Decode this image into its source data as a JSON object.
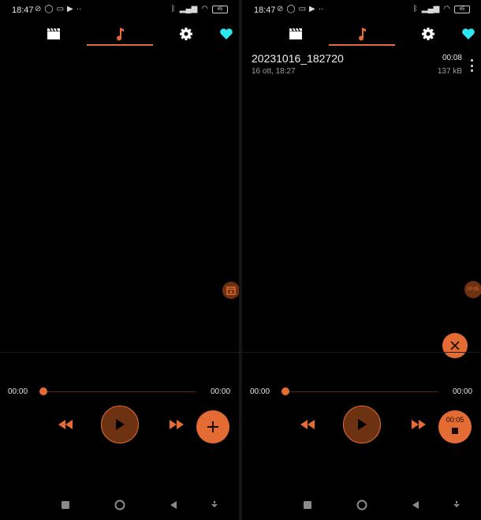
{
  "theme": {
    "accent": "#e56b34",
    "accent_dark": "#6d3212",
    "background": "#000000",
    "favorite_color": "#2ee6f0"
  },
  "status_bar": {
    "time": "18:47",
    "left_icons": [
      "notification-muted-icon",
      "whatsapp-icon",
      "mail-icon",
      "play-store-icon",
      "more-dots"
    ],
    "right_icons": [
      "bluetooth-icon",
      "signal-icon",
      "wifi-icon",
      "battery-icon"
    ],
    "battery": "45"
  },
  "tabs": [
    {
      "name": "video",
      "icon": "clapperboard-icon",
      "selected": false
    },
    {
      "name": "audio",
      "icon": "music-note-icon",
      "selected": true
    },
    {
      "name": "settings",
      "icon": "gear-icon",
      "selected": false
    },
    {
      "name": "favorites",
      "icon": "heart-icon",
      "selected": false
    }
  ],
  "left_screen": {
    "player": {
      "current": "00:00",
      "total": "00:00"
    },
    "fab": {
      "icon": "plus-icon"
    }
  },
  "right_screen": {
    "recordings": [
      {
        "title": "20231016_182720",
        "date": "16 ott, 18:27",
        "duration": "00:08",
        "size": "137 kB"
      }
    ],
    "floating_timer": "00:05",
    "cancel_icon": "close-icon",
    "player": {
      "current": "00:00",
      "total": "00:00"
    },
    "fab": {
      "icon": "stop-icon",
      "timer": "00:05"
    }
  },
  "nav_bar": [
    "recents-square-icon",
    "home-circle-icon",
    "back-triangle-icon",
    "assistant-icon"
  ]
}
